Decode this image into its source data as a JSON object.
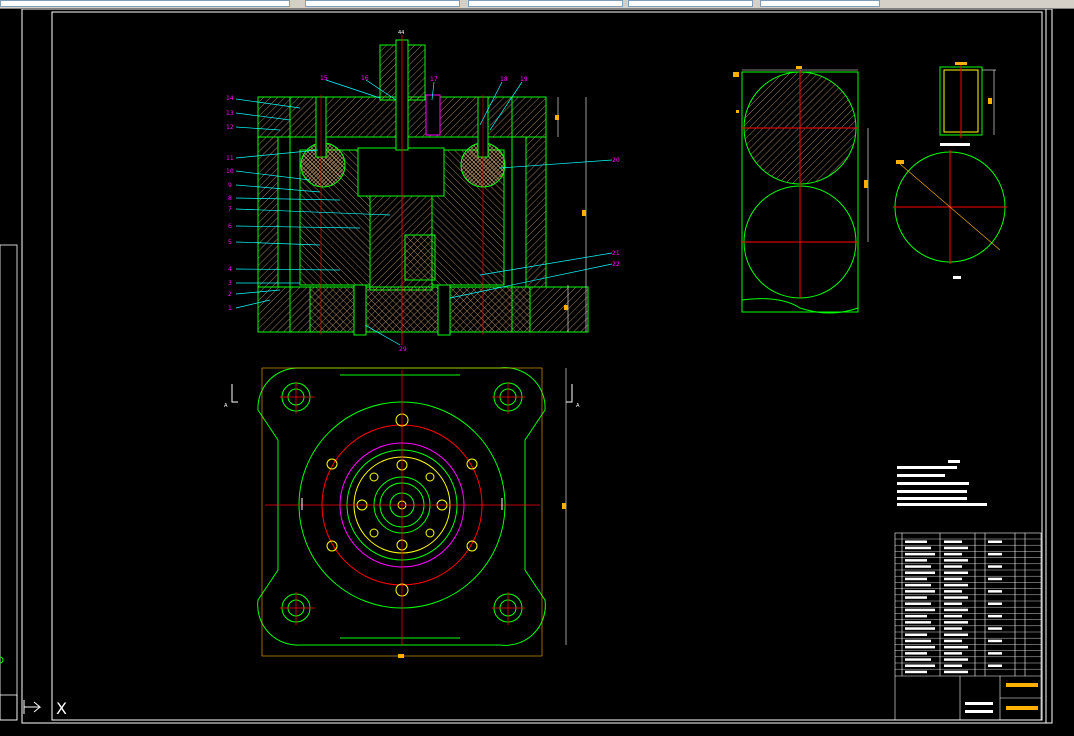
{
  "app": {
    "background": "#000000",
    "toolbar_color": "#d4d0c8"
  },
  "colors": {
    "outline": "#00ff00",
    "center": "#ff0000",
    "hatch": "#c8a070",
    "leader": "#00ffff",
    "label": "#ff00ff",
    "dimension": "#ffb000",
    "frame": "#ffffff",
    "bolt": "#ffff00"
  },
  "section_view": {
    "top_mark": "44",
    "bottom_mark": "29",
    "left_labels": [
      "14",
      "13",
      "12",
      "11",
      "10",
      "9",
      "8",
      "7",
      "6",
      "5",
      "4",
      "3",
      "2",
      "1"
    ],
    "top_labels": [
      "15",
      "16",
      "17",
      "18",
      "19"
    ],
    "right_labels": [
      "20",
      "21",
      "22"
    ]
  },
  "section_marker": "A",
  "ucs_icon": {
    "x_label": "X"
  }
}
